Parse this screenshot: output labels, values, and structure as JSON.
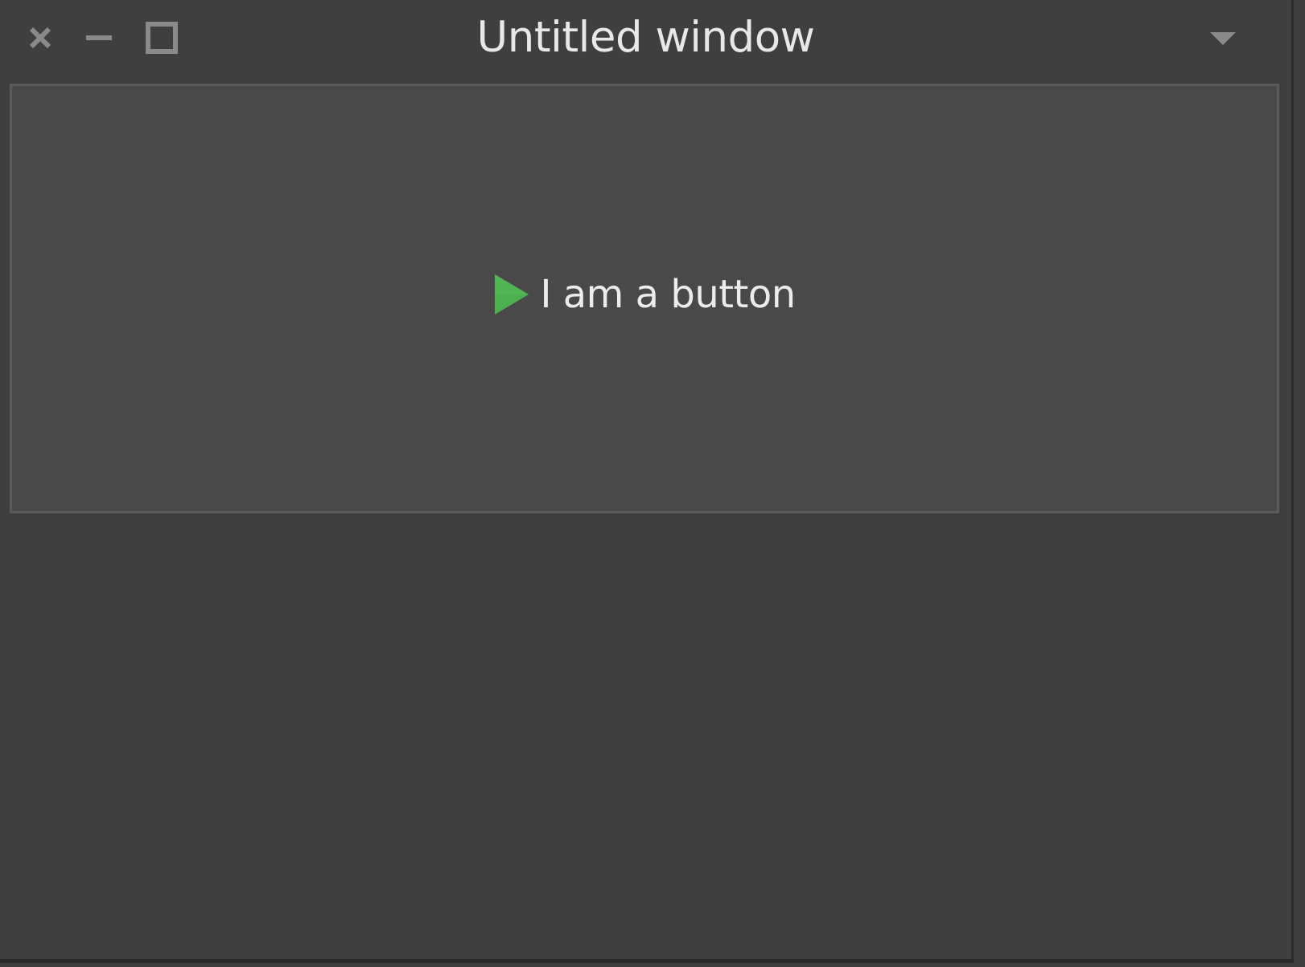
{
  "window": {
    "title": "Untitled window"
  },
  "titlebar": {
    "close_icon": "close-icon",
    "minimize_icon": "minimize-icon",
    "maximize_icon": "maximize-icon",
    "menu_icon": "chevron-down-icon"
  },
  "button": {
    "label": "I am a button",
    "icon": "play-icon",
    "icon_color": "#4caf50"
  },
  "colors": {
    "background": "#3f3f3f",
    "button_background": "#494949",
    "button_border": "#5b5b5b",
    "text": "#e8e8e8",
    "titlebar_icons": "#8a8a8a"
  }
}
